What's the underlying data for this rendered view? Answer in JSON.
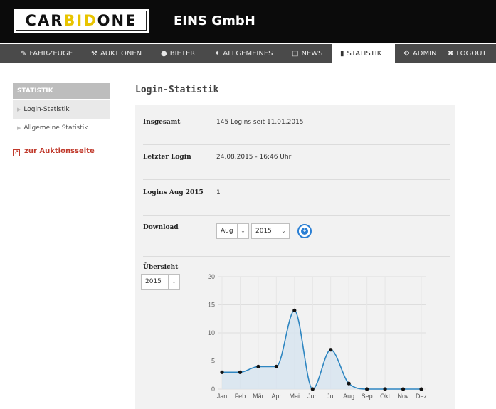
{
  "header": {
    "logo": {
      "part1": "CAR",
      "part2": "BID",
      "part3": "ONE"
    },
    "company": "EINS GmbH"
  },
  "nav": {
    "items": [
      {
        "label": "FAHRZEUGE",
        "icon": "edit-icon"
      },
      {
        "label": "AUKTIONEN",
        "icon": "gavel-icon"
      },
      {
        "label": "BIETER",
        "icon": "user-icon"
      },
      {
        "label": "ALLGEMEINES",
        "icon": "wrench-icon"
      },
      {
        "label": "NEWS",
        "icon": "document-icon"
      },
      {
        "label": "STATISTIK",
        "icon": "bar-chart-icon",
        "active": true
      },
      {
        "label": "ADMIN",
        "icon": "gear-icon"
      },
      {
        "label": "LOGOUT",
        "icon": "close-icon"
      }
    ]
  },
  "sidebar": {
    "heading": "STATISTIK",
    "items": [
      {
        "label": "Login-Statistik",
        "selected": true
      },
      {
        "label": "Allgemeine Statistik",
        "selected": false
      }
    ],
    "auction_link": "zur Auktionsseite"
  },
  "main": {
    "title": "Login-Statistik",
    "rows": [
      {
        "label": "Insgesamt",
        "value": "145 Logins seit 11.01.2015"
      },
      {
        "label": "Letzter Login",
        "value": "24.08.2015 - 16:46 Uhr"
      },
      {
        "label": "Logins Aug 2015",
        "value": "1"
      }
    ],
    "download": {
      "label": "Download",
      "month": "Aug",
      "year": "2015"
    },
    "overview": {
      "label": "Übersicht",
      "year": "2015"
    }
  },
  "colors": {
    "accent": "#2a7fd4",
    "brand_yellow": "#e8c400",
    "link_red": "#c0392b"
  },
  "chart_data": {
    "type": "area",
    "categories": [
      "Jan",
      "Feb",
      "Mär",
      "Apr",
      "Mai",
      "Jun",
      "Jul",
      "Aug",
      "Sep",
      "Okt",
      "Nov",
      "Dez"
    ],
    "series": [
      {
        "values": [
          3,
          3,
          4,
          4,
          14,
          0,
          7,
          1,
          0,
          0,
          0,
          0
        ]
      }
    ],
    "ylim": [
      0,
      20
    ],
    "yticks": [
      0,
      5,
      10,
      15,
      20
    ],
    "grid": true,
    "colors": {
      "line": "#2e86c1",
      "fill": "#d6e4ef",
      "point": "#111111"
    }
  }
}
